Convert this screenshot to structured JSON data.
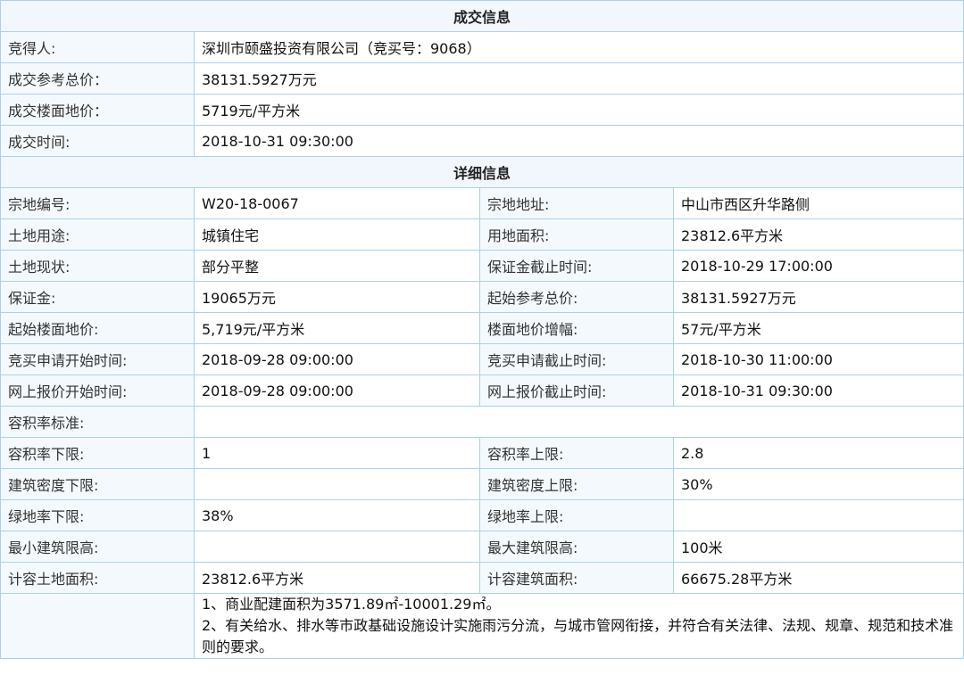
{
  "deal": {
    "title": "成交信息",
    "rows": [
      {
        "label": "竞得人:",
        "value": "深圳市颐盛投资有限公司（竞买号：9068）"
      },
      {
        "label": "成交参考总价：",
        "value": "38131.5927万元"
      },
      {
        "label": "成交楼面地价：",
        "value": "5719元/平方米"
      },
      {
        "label": "成交时间:",
        "value": "2018-10-31 09:30:00"
      }
    ]
  },
  "detail": {
    "title": "详细信息",
    "rows": [
      {
        "l1": "宗地编号:",
        "v1": "W20-18-0067",
        "l2": "宗地地址:",
        "v2": "中山市西区升华路侧"
      },
      {
        "l1": "土地用途:",
        "v1": "城镇住宅",
        "l2": "用地面积:",
        "v2": "23812.6平方米"
      },
      {
        "l1": "土地现状:",
        "v1": "部分平整",
        "l2": "保证金截止时间:",
        "v2": "2018-10-29 17:00:00"
      },
      {
        "l1": "保证金:",
        "v1": "19065万元",
        "l2": "起始参考总价:",
        "v2": "38131.5927万元"
      },
      {
        "l1": "起始楼面地价:",
        "v1": "5,719元/平方米",
        "l2": "楼面地价增幅:",
        "v2": "57元/平方米"
      },
      {
        "l1": "竞买申请开始时间:",
        "v1": "2018-09-28 09:00:00",
        "l2": "竞买申请截止时间:",
        "v2": "2018-10-30 11:00:00"
      },
      {
        "l1": "网上报价开始时间:",
        "v1": "2018-09-28 09:00:00",
        "l2": "网上报价截止时间:",
        "v2": "2018-10-31 09:30:00"
      }
    ],
    "plot_ratio_standard": {
      "label": "容积率标准:",
      "value": ""
    },
    "rows2": [
      {
        "l1": "容积率下限:",
        "v1": "1",
        "l2": "容积率上限:",
        "v2": "2.8"
      },
      {
        "l1": "建筑密度下限:",
        "v1": "",
        "l2": "建筑密度上限:",
        "v2": "30%"
      },
      {
        "l1": "绿地率下限:",
        "v1": "38%",
        "l2": "绿地率上限:",
        "v2": ""
      },
      {
        "l1": "最小建筑限高:",
        "v1": "",
        "l2": "最大建筑限高:",
        "v2": "100米"
      },
      {
        "l1": "计容土地面积:",
        "v1": "23812.6平方米",
        "l2": "计容建筑面积:",
        "v2": "66675.28平方米"
      }
    ],
    "notes": {
      "label": "",
      "lines": [
        "1、商业配建面积为3571.89㎡-10001.29㎡。",
        "2、有关给水、排水等市政基础设施设计实施雨污分流，与城市管网衔接，并符合有关法律、法规、规章、规范和技术准则的要求。"
      ]
    }
  }
}
